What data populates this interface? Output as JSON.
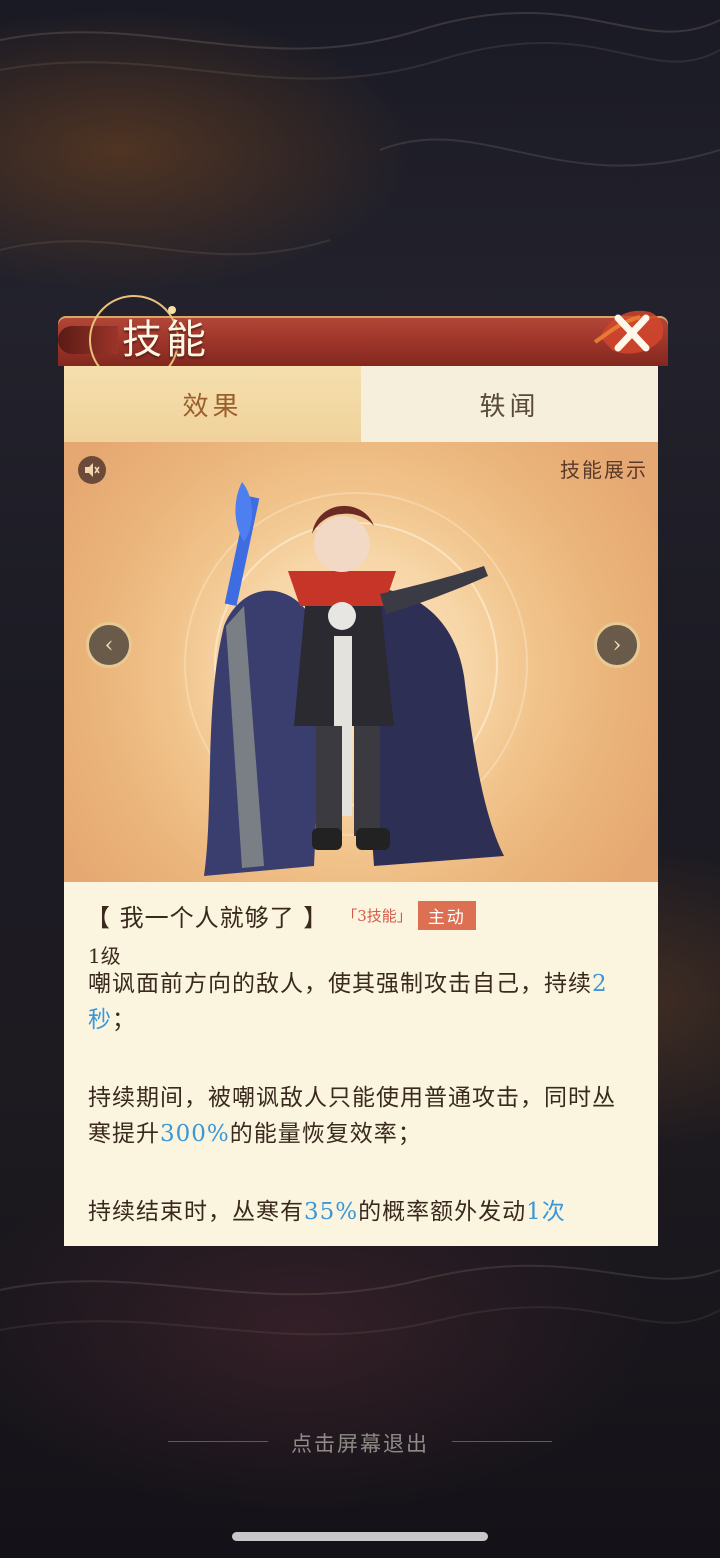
{
  "header": {
    "title": "技能",
    "close_icon": "close-x-icon"
  },
  "tabs": [
    {
      "label": "效果",
      "active": true
    },
    {
      "label": "轶闻",
      "active": false
    }
  ],
  "preview": {
    "showcase_label": "技能展示",
    "mute_icon": "mute-speaker-icon",
    "prev_icon": "chevron-left-icon",
    "next_icon": "chevron-right-icon"
  },
  "skill": {
    "name": "【 我一个人就够了 】",
    "type_tag": "「3技能」",
    "active_tag": "主动",
    "level": "1级",
    "p1_a": "嘲讽面前方向的敌人，使其强制攻击自己，持续",
    "p1_v1": "2秒",
    "p1_b": "；",
    "p2_a": "持续期间，被嘲讽敌人只能使用普通攻击，同时丛寒提升",
    "p2_v1": "300%",
    "p2_b": "的能量恢复效率；",
    "p3_a": "持续结束时，丛寒有",
    "p3_v1": "35%",
    "p3_b": "的概率额外发动",
    "p3_v2": "1次"
  },
  "footer": {
    "exit_hint": "点击屏幕退出"
  },
  "colors": {
    "highlight": "#3a97d8",
    "title_bar": "#9c3429",
    "active_tag": "#dd6f52"
  }
}
